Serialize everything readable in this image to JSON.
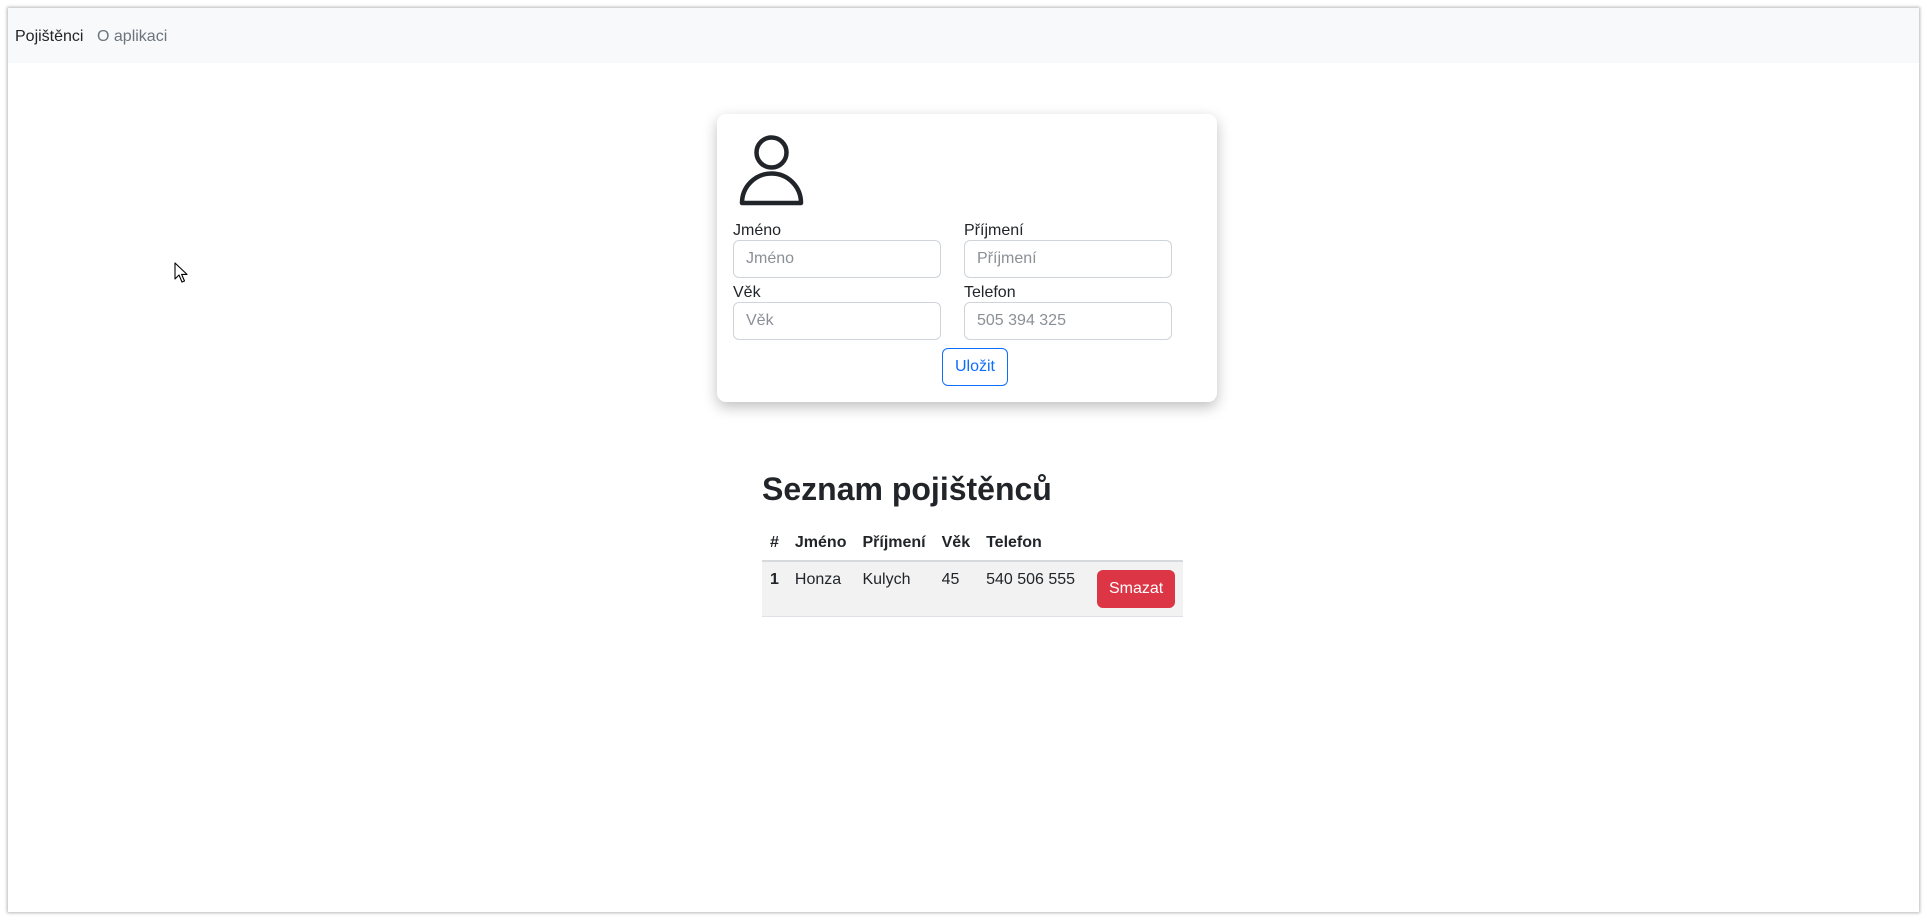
{
  "navbar": {
    "brand": "Pojištěnci",
    "about": "O aplikaci"
  },
  "form": {
    "avatar_icon": "person-icon",
    "first_name_label": "Jméno",
    "first_name_placeholder": "Jméno",
    "first_name_value": "",
    "last_name_label": "Příjmení",
    "last_name_placeholder": "Příjmení",
    "last_name_value": "",
    "age_label": "Věk",
    "age_placeholder": "Věk",
    "age_value": "",
    "phone_label": "Telefon",
    "phone_placeholder": "505 394 325",
    "phone_value": "",
    "save_label": "Uložit"
  },
  "list": {
    "title": "Seznam pojištěnců",
    "columns": [
      "#",
      "Jméno",
      "Příjmení",
      "Věk",
      "Telefon"
    ],
    "rows": [
      {
        "num": "1",
        "first_name": "Honza",
        "last_name": "Kulych",
        "age": "45",
        "phone": "540 506 555",
        "delete_label": "Smazat"
      }
    ]
  },
  "colors": {
    "navbar_bg": "#f8f9fa",
    "primary": "#0d6efd",
    "danger": "#dc3545",
    "muted": "#6c757d",
    "row_bg": "#f2f2f2"
  }
}
